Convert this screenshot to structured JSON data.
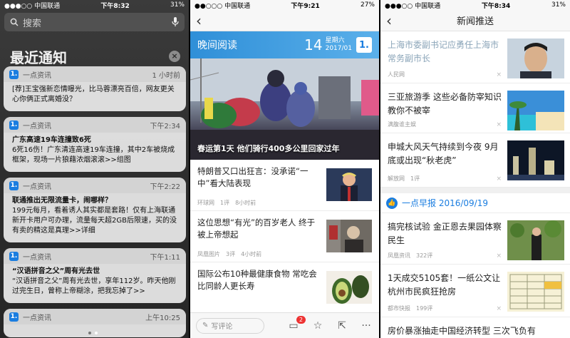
{
  "status_left": {
    "carrier": "中国联通",
    "time": "下午8:32",
    "battery": "31%"
  },
  "status_mid": {
    "carrier": "中国联通",
    "time": "下午9:21",
    "battery": "27%"
  },
  "status_right": {
    "carrier": "中国联通",
    "time": "下午8:34",
    "battery": "31%"
  },
  "notifications": {
    "search_placeholder": "搜索",
    "title": "最近通知",
    "clear": "×",
    "items": [
      {
        "app": "一点资讯",
        "time": "1 小时前",
        "title": "",
        "body": "[荐]王宝强新恋情曝光，比马蓉漂亮百倍，网友更关心你俩正式离婚没？"
      },
      {
        "app": "一点资讯",
        "time": "下午2:34",
        "title": "广东高速19车连撞致6死",
        "body": "6死16伤！广东清连高速19车连撞，其中2车被烧成框架，现场一片狼藉浓烟滚滚>>组图"
      },
      {
        "app": "一点资讯",
        "time": "下午2:22",
        "title": "联通推出无限流量卡，闹哪样？",
        "body": "199元每月，看着诱人其实都是套路！仅有上海联通新开卡用户可办理，流量每天超2GB后限速，买的没有卖的精这是真理>>详细"
      },
      {
        "app": "一点资讯",
        "time": "下午1:11",
        "title": "“汉语拼音之父”周有光去世",
        "body": "“汉语拼音之父”周有光去世，享年112岁。昨天他刚过完生日，曾称上帝糊涂，把我忘掉了>>"
      },
      {
        "app": "一点资讯",
        "time": "上午10:25",
        "title": "",
        "body": ""
      }
    ]
  },
  "reader": {
    "back": "‹",
    "evening_title": "晚间阅读",
    "day": "14",
    "weekday": "星期六",
    "yearmonth": "2017/01",
    "logo": "1.",
    "hero_caption": "春运第1天 他们骑行400多公里回家过年",
    "articles": [
      {
        "title": "特朗普又口出狂言：没承诺“一中”看大陆表现",
        "source": "环球网",
        "comments": "1评",
        "time": "8小时前"
      },
      {
        "title": "这位思想“有光”的百岁老人 终于被上帝想起",
        "source": "凤凰图片",
        "comments": "3评",
        "time": "4小时前"
      },
      {
        "title": "国际公布10种最健康食物 常吃会比同龄人更长寿",
        "source": "",
        "comments": "",
        "time": ""
      }
    ],
    "comment_placeholder": "写评论",
    "comment_badge": "2"
  },
  "push": {
    "back": "‹",
    "title": "新闻推送",
    "items": [
      {
        "title": "上海市委副书记应勇任上海市常务副市长",
        "source": "人民网",
        "comments": "",
        "read": true
      },
      {
        "title": "三亚旅游季 这些必备防宰知识教你不被宰",
        "source": "满腹谁主娱",
        "comments": "",
        "read": false
      },
      {
        "title": "申城大风天气持续到今夜 9月底或出现“秋老虎”",
        "source": "解放网",
        "comments": "1评",
        "read": false
      }
    ],
    "morning_label": "一点早报 2016/09/19",
    "morning_items": [
      {
        "title": "搞完核试验 金正恩去果园体察民生",
        "source": "凤凰资讯",
        "comments": "322评"
      },
      {
        "title": "1天成交5105套！一纸公文让杭州市民疯狂抢房",
        "source": "都市快报",
        "comments": "199评"
      },
      {
        "title": "房价暴涨抽走中国经济转型 三次飞负有",
        "source": "",
        "comments": ""
      }
    ]
  }
}
